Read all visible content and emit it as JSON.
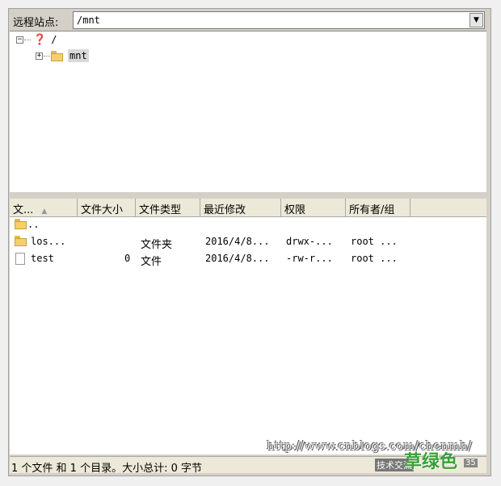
{
  "address": {
    "label": "远程站点:",
    "value": "/mnt"
  },
  "tree": {
    "root": {
      "expander": "⊟",
      "label": "/"
    },
    "child": {
      "expander": "⊞",
      "label": "mnt"
    }
  },
  "columns": [
    "文...",
    "文件大小",
    "文件类型",
    "最近修改",
    "权限",
    "所有者/组"
  ],
  "rows": [
    {
      "name": "..",
      "size": "",
      "type": "",
      "modified": "",
      "perm": "",
      "owner": ""
    },
    {
      "name": "los...",
      "size": "",
      "type": "文件夹",
      "modified": "2016/4/8...",
      "perm": "drwx-...",
      "owner": "root ..."
    },
    {
      "name": "test",
      "size": "0",
      "type": "文件",
      "modified": "2016/4/8...",
      "perm": "-rw-r...",
      "owner": "root ..."
    }
  ],
  "status": "1 个文件 和 1 个目录。大小总计: 0 字节",
  "watermark": {
    "url": "http://www.cnblogs.com/chenmh/",
    "title": "草绿色",
    "small": "技术交流",
    "num": "35"
  }
}
